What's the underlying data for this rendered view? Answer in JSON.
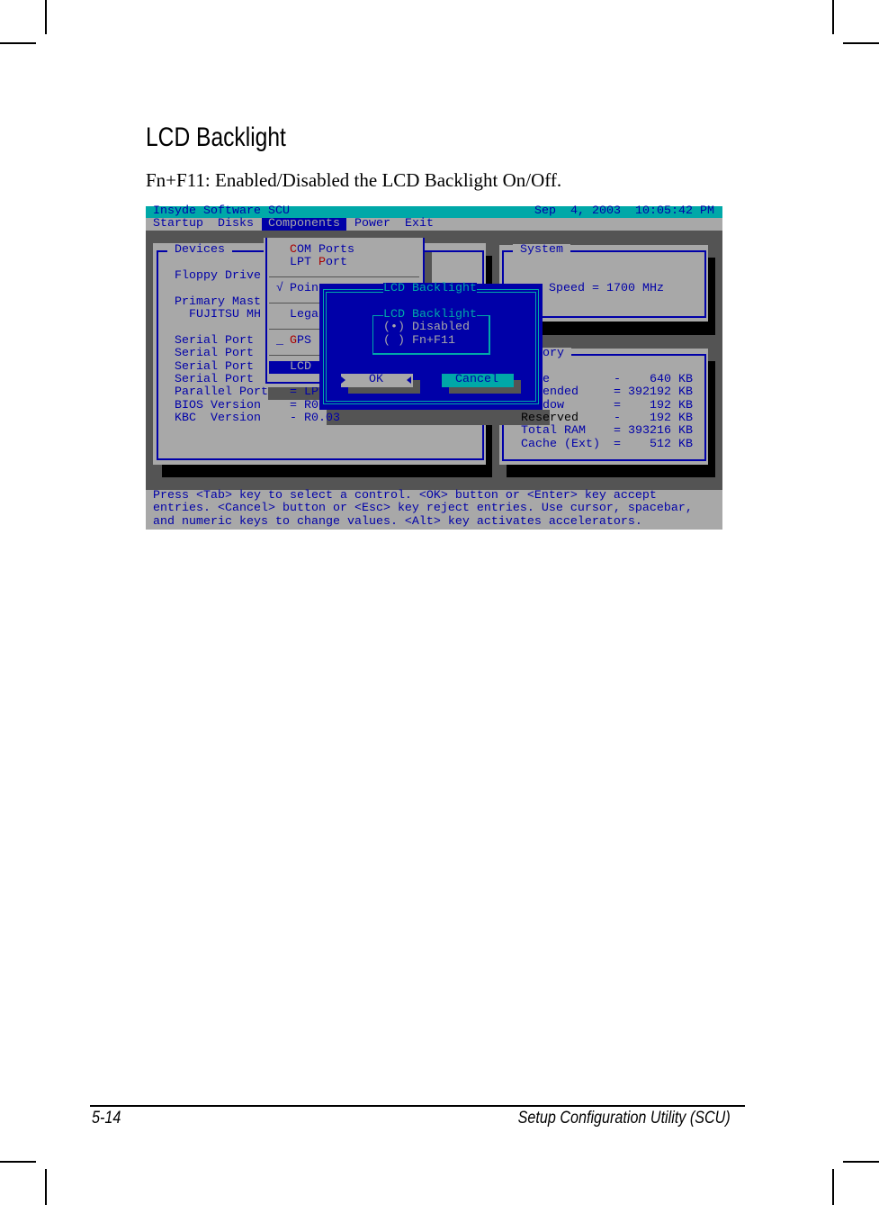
{
  "page": {
    "heading": "LCD Backlight",
    "description": "Fn+F11: Enabled/Disabled the LCD Backlight On/Off.",
    "footer_left": "5-14",
    "footer_right": "Setup Configuration Utility (SCU)"
  },
  "colors": {
    "blue": "#0000a8",
    "gray": "#a8a8a8",
    "cyan": "#00a8a8",
    "dark": "#545454",
    "red": "#a80000"
  },
  "bios": {
    "title": "Insyde Software SCU",
    "datetime": "Sep  4, 2003  10:05:42 PM",
    "menu": [
      "Startup",
      "Disks",
      "Components",
      "Power",
      "Exit"
    ],
    "devices": {
      "title": "Devices",
      "floppy": "Floppy Drive",
      "primary": "Primary Mast",
      "primary_dev": "FUJITSU MH",
      "serial": [
        "Serial Port",
        "Serial Port",
        "Serial Port",
        "Serial Port"
      ],
      "parallel": "Parallel Port",
      "bios_ver": "BIOS Version",
      "kbc_ver": "KBC  Version",
      "parallel_val": "= LP",
      "bios_val": "= R0",
      "kbc_val": "- R0.03"
    },
    "components_menu": {
      "com_hot": "C",
      "com_rest": "OM Ports",
      "lpt_a": "LPT ",
      "lpt_hot": "P",
      "lpt_rest": "ort",
      "pointing_check": "√",
      "pointing": "Poin",
      "legacy": "Lega",
      "gps_mark": "_",
      "gps_hot": "G",
      "gps_rest": "PS",
      "lcd": "LCD"
    },
    "system": {
      "title": "System",
      "speed": "Speed = 1700 MHz"
    },
    "memory": {
      "title": "ory",
      "rows": [
        {
          "label": "e",
          "value": "-    640 KB"
        },
        {
          "label": "ended",
          "value": "= 392192 KB"
        },
        {
          "label": "dow",
          "value": "=    192 KB"
        },
        {
          "label": "Reserved",
          "value": "-    192 KB"
        },
        {
          "label": "Total RAM",
          "value": "= 393216 KB"
        },
        {
          "label": "Cache (Ext)",
          "value": "=    512 KB"
        }
      ]
    },
    "dialog": {
      "title": "LCD Backlight",
      "group_title": "LCD Backlight",
      "options": [
        {
          "mark": "(•)",
          "label": "Disabled",
          "selected": true
        },
        {
          "mark": "( )",
          "label": "Fn+F11",
          "selected": false
        }
      ],
      "ok": "OK",
      "cancel": "Cancel"
    },
    "help": [
      "Press <Tab> key to select a control. <OK> button or <Enter> key accept",
      "entries. <Cancel> button or <Esc> key reject entries. Use cursor, spacebar,",
      "and numeric keys to change values. <Alt> key activates accelerators."
    ]
  }
}
